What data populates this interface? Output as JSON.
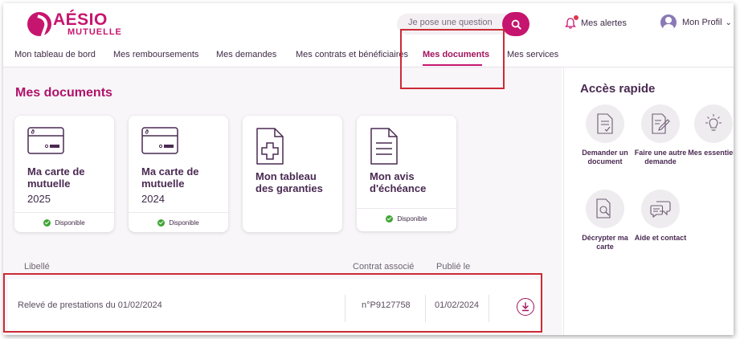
{
  "brand": {
    "name": "AÉSIO",
    "subname": "MUTUELLE",
    "color": "#c6156e"
  },
  "header": {
    "search_placeholder": "Je pose une question",
    "alerts_label": "Mes alertes",
    "profile_label": "Mon Profil"
  },
  "nav": {
    "items": [
      {
        "label": "Mon tableau de bord",
        "active": false
      },
      {
        "label": "Mes remboursements",
        "active": false
      },
      {
        "label": "Mes demandes",
        "active": false
      },
      {
        "label": "Mes contrats et bénéficiaires",
        "active": false
      },
      {
        "label": "Mes documents",
        "active": true
      },
      {
        "label": "Mes services",
        "active": false
      }
    ]
  },
  "main": {
    "title": "Mes documents",
    "cards": [
      {
        "title": "Ma carte de mutuelle",
        "year": "2025",
        "status": "Disponible",
        "icon": "card-icon"
      },
      {
        "title": "Ma carte de mutuelle",
        "year": "2024",
        "status": "Disponible",
        "icon": "card-icon"
      },
      {
        "title": "Mon tableau des garanties",
        "icon": "health-document-icon"
      },
      {
        "title": "Mon avis d'échéance",
        "status": "Disponible",
        "icon": "document-icon"
      }
    ],
    "table": {
      "headers": {
        "label": "Libellé",
        "contract": "Contrat associé",
        "published": "Publié le"
      },
      "rows": [
        {
          "label": "Relevé de prestations du 01/02/2024",
          "contract": "n°P9127758",
          "published": "01/02/2024"
        }
      ]
    }
  },
  "sidebar": {
    "title": "Accès rapide",
    "items": [
      {
        "label": "Demander un document",
        "icon": "document-check-icon"
      },
      {
        "label": "Faire une autre demande",
        "icon": "edit-document-icon"
      },
      {
        "label": "Mes essentiels",
        "icon": "lightbulb-icon"
      },
      {
        "label": "Décrypter ma carte",
        "icon": "magnify-document-icon"
      },
      {
        "label": "Aide et contact",
        "icon": "chat-bubbles-icon"
      }
    ]
  },
  "colors": {
    "accent": "#c6156e",
    "active_nav": "#a3125e",
    "available": "#3fa535",
    "highlight": "#cc2a36"
  }
}
